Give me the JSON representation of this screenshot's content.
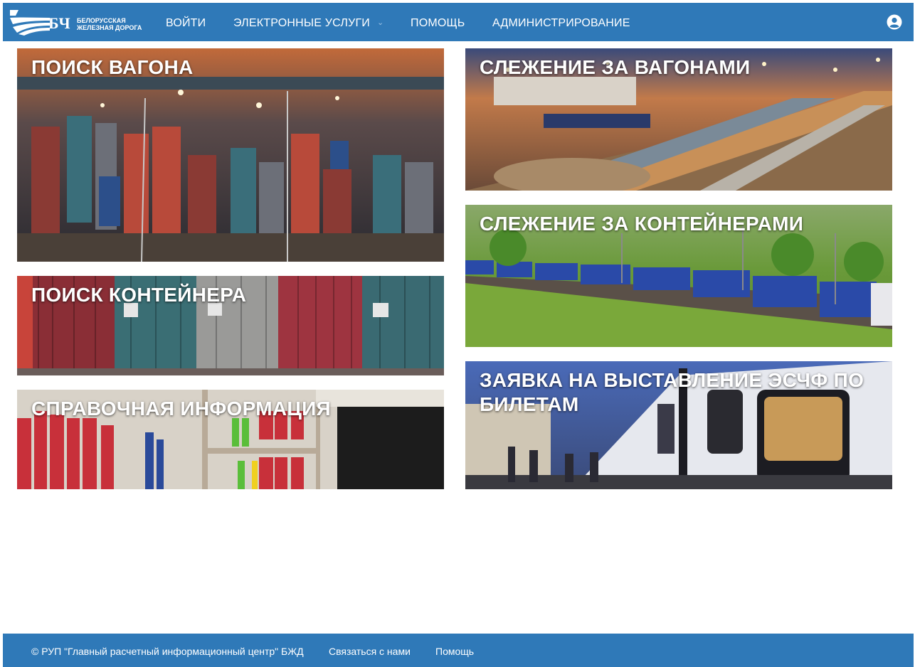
{
  "header": {
    "logo_abbr": "БЧ",
    "logo_line1": "БЕЛОРУССКАЯ",
    "logo_line2": "ЖЕЛЕЗНАЯ ДОРОГА",
    "nav": {
      "login": "ВОЙТИ",
      "services": "ЭЛЕКТРОННЫЕ УСЛУГИ",
      "help": "ПОМОЩЬ",
      "admin": "АДМИНИСТРИРОВАНИЕ"
    },
    "icons": {
      "services_dropdown": "chevron-down-icon",
      "user": "user-account-icon"
    },
    "color": "#2f79b8"
  },
  "tiles": {
    "wagon_search": "ПОИСК ВАГОНА",
    "container_search": "ПОИСК КОНТЕЙНЕРА",
    "reference_info": "СПРАВОЧНАЯ ИНФОРМАЦИЯ",
    "track_wagons": "СЛЕЖЕНИЕ ЗА ВАГОНАМИ",
    "track_containers": "СЛЕЖЕНИЕ ЗА КОНТЕЙНЕРАМИ",
    "esf_request": "ЗАЯВКА НА ВЫСТАВЛЕНИЕ ЭСЧФ ПО БИЛЕТАМ"
  },
  "footer": {
    "copyright": "© РУП \"Главный расчетный информационный центр\" БЖД",
    "contact": "Связаться с нами",
    "help": "Помощь"
  }
}
